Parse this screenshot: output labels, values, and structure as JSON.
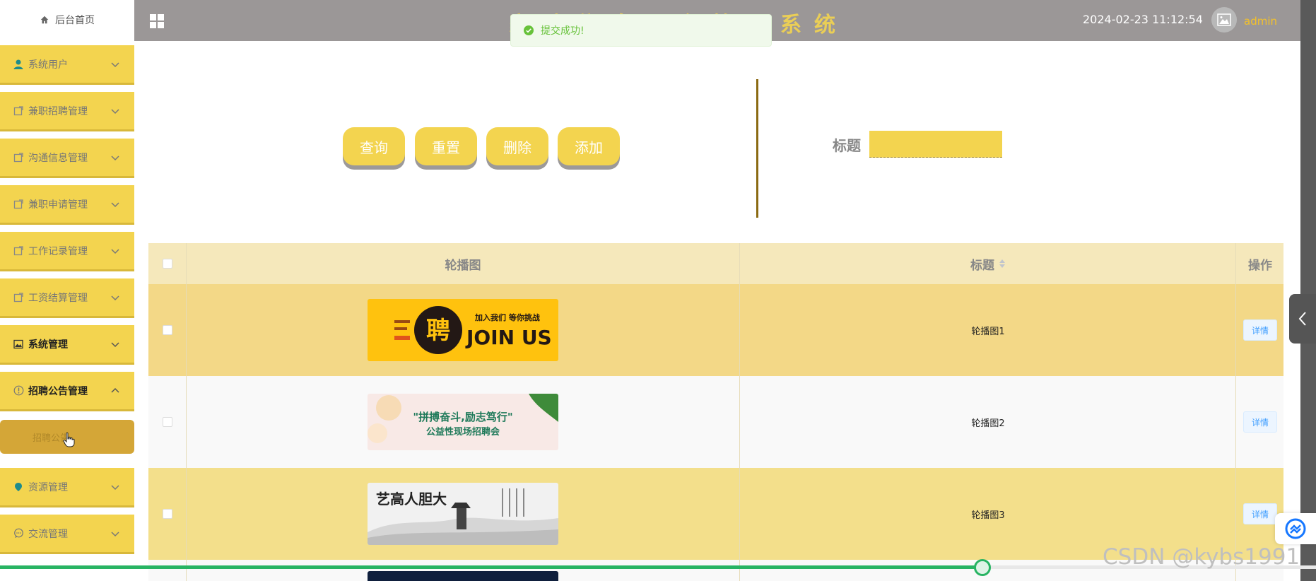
{
  "header": {
    "system_title": "家政信息平台管理系统",
    "datetime": "2024-02-23 11:12:54",
    "username": "admin"
  },
  "toast": {
    "message": "提交成功!"
  },
  "sidebar": {
    "home": "后台首页",
    "items": [
      {
        "label": "系统用户",
        "icon": "user-icon"
      },
      {
        "label": "兼职招聘管理",
        "icon": "document-icon"
      },
      {
        "label": "沟通信息管理",
        "icon": "document-icon"
      },
      {
        "label": "兼职申请管理",
        "icon": "document-icon"
      },
      {
        "label": "工作记录管理",
        "icon": "document-icon"
      },
      {
        "label": "工资结算管理",
        "icon": "document-icon"
      },
      {
        "label": "系统管理",
        "icon": "image-icon"
      },
      {
        "label": "招聘公告管理",
        "icon": "info-icon"
      },
      {
        "label": "资源管理",
        "icon": "location-icon"
      },
      {
        "label": "交流管理",
        "icon": "chat-icon"
      }
    ],
    "active_sub": "招聘公告"
  },
  "toolbar": {
    "query": "查询",
    "reset": "重置",
    "delete": "删除",
    "add": "添加"
  },
  "search": {
    "title_label": "标题",
    "title_value": ""
  },
  "table": {
    "headers": {
      "image": "轮播图",
      "title": "标题",
      "op": "操作"
    },
    "rows": [
      {
        "title": "轮播图1",
        "detail": "详情",
        "banner_text": "JOIN US",
        "banner_sub": "加入我们 等你挑战"
      },
      {
        "title": "轮播图2",
        "detail": "详情",
        "banner_text": "\"拼搏奋斗,励志笃行\"",
        "banner_sub": "公益性现场招聘会"
      },
      {
        "title": "轮播图3",
        "detail": "详情",
        "banner_text": "艺高人胆大",
        "banner_sub": ""
      }
    ]
  },
  "watermark": "CSDN @kybs1991",
  "colors": {
    "accent": "#f3d44f",
    "header": "#9b9797",
    "success": "#67c23a",
    "link": "#409eff"
  }
}
